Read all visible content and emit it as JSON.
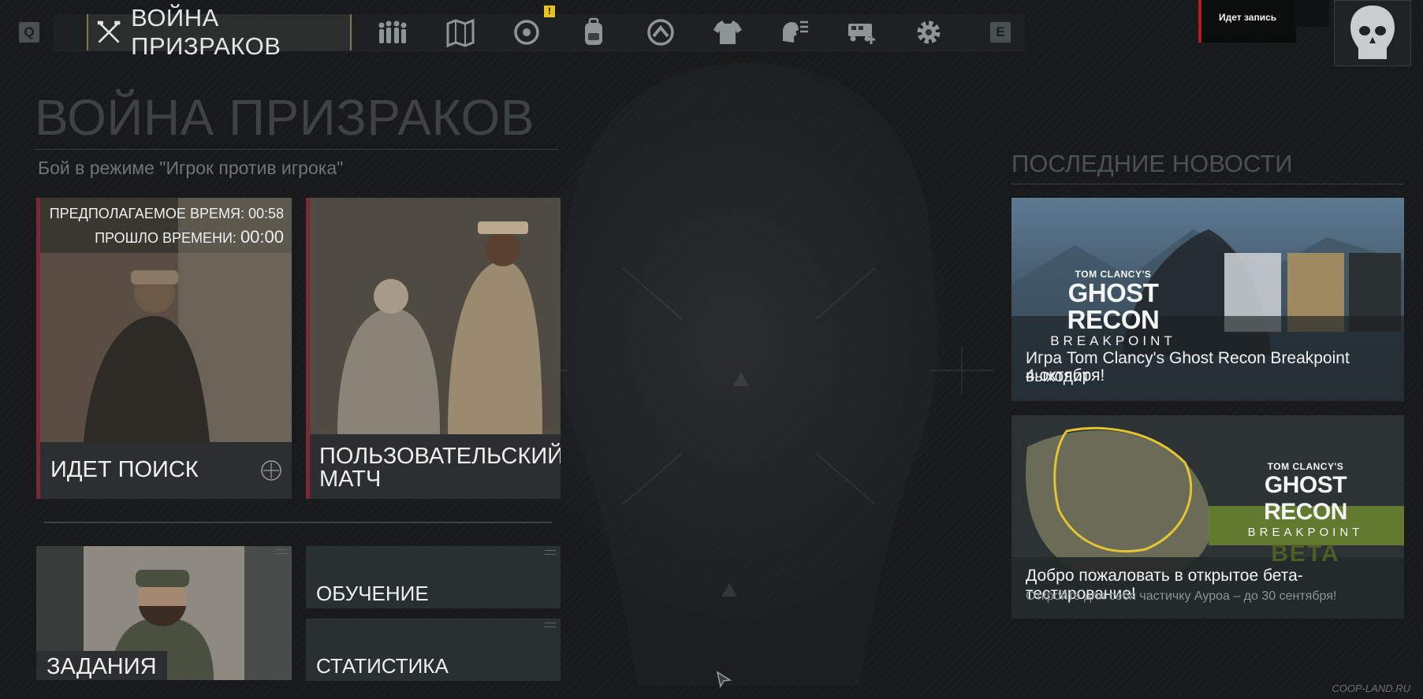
{
  "topbar": {
    "key_left": "Q",
    "key_right": "E",
    "mode_title": "ВОЙНА ПРИЗРАКОВ",
    "alert": "!",
    "nav_icons": [
      "squad-icon",
      "map-icon",
      "target-icon",
      "backpack-icon",
      "rank-icon",
      "outfit-icon",
      "intel-icon",
      "vehicle-icon",
      "settings-icon"
    ]
  },
  "recording": {
    "label": "Идет запись"
  },
  "page": {
    "title": "ВОЙНА ПРИЗРАКОВ",
    "subtitle": "Бой в режиме \"Игрок против игрока\""
  },
  "search_tile": {
    "estimated_label": "ПРЕДПОЛАГАЕМОЕ ВРЕМЯ: 00:58",
    "elapsed_label": "ПРОШЛО ВРЕМЕНИ:",
    "elapsed_value": "00:00",
    "label": "ИДЕТ ПОИСК"
  },
  "custom_tile": {
    "label_line1": "ПОЛЬЗОВАТЕЛЬСКИЙ",
    "label_line2": "МАТЧ"
  },
  "missions_tile": {
    "label": "ЗАДАНИЯ"
  },
  "training_tile": {
    "label": "ОБУЧЕНИЕ"
  },
  "stats_tile": {
    "label": "СТАТИСТИКА"
  },
  "news": {
    "title": "ПОСЛЕДНИЕ НОВОСТИ",
    "items": [
      {
        "logo_top": "TOM CLANCY'S",
        "logo_main": "GHOST RECON",
        "logo_sub": "BREAKPOINT",
        "caption_line1": "Игра Tom Clancy's Ghost Recon Breakpoint выходит",
        "caption_line2": "4 октября!"
      },
      {
        "logo_top": "TOM CLANCY'S",
        "logo_main": "GHOST RECON",
        "logo_sub": "BREAKPOINT",
        "logo_beta": "BETA",
        "caption": "Добро пожаловать в открытое бета-тестирование!",
        "subcaption": "Откройте для себя частичку Ауроа – до 30 сентября!"
      }
    ]
  },
  "watermark": "COOP-LAND.RU",
  "colors": {
    "accent_red": "#7d2837",
    "alert_yellow": "#e8c220",
    "record_red": "#b01c22"
  }
}
